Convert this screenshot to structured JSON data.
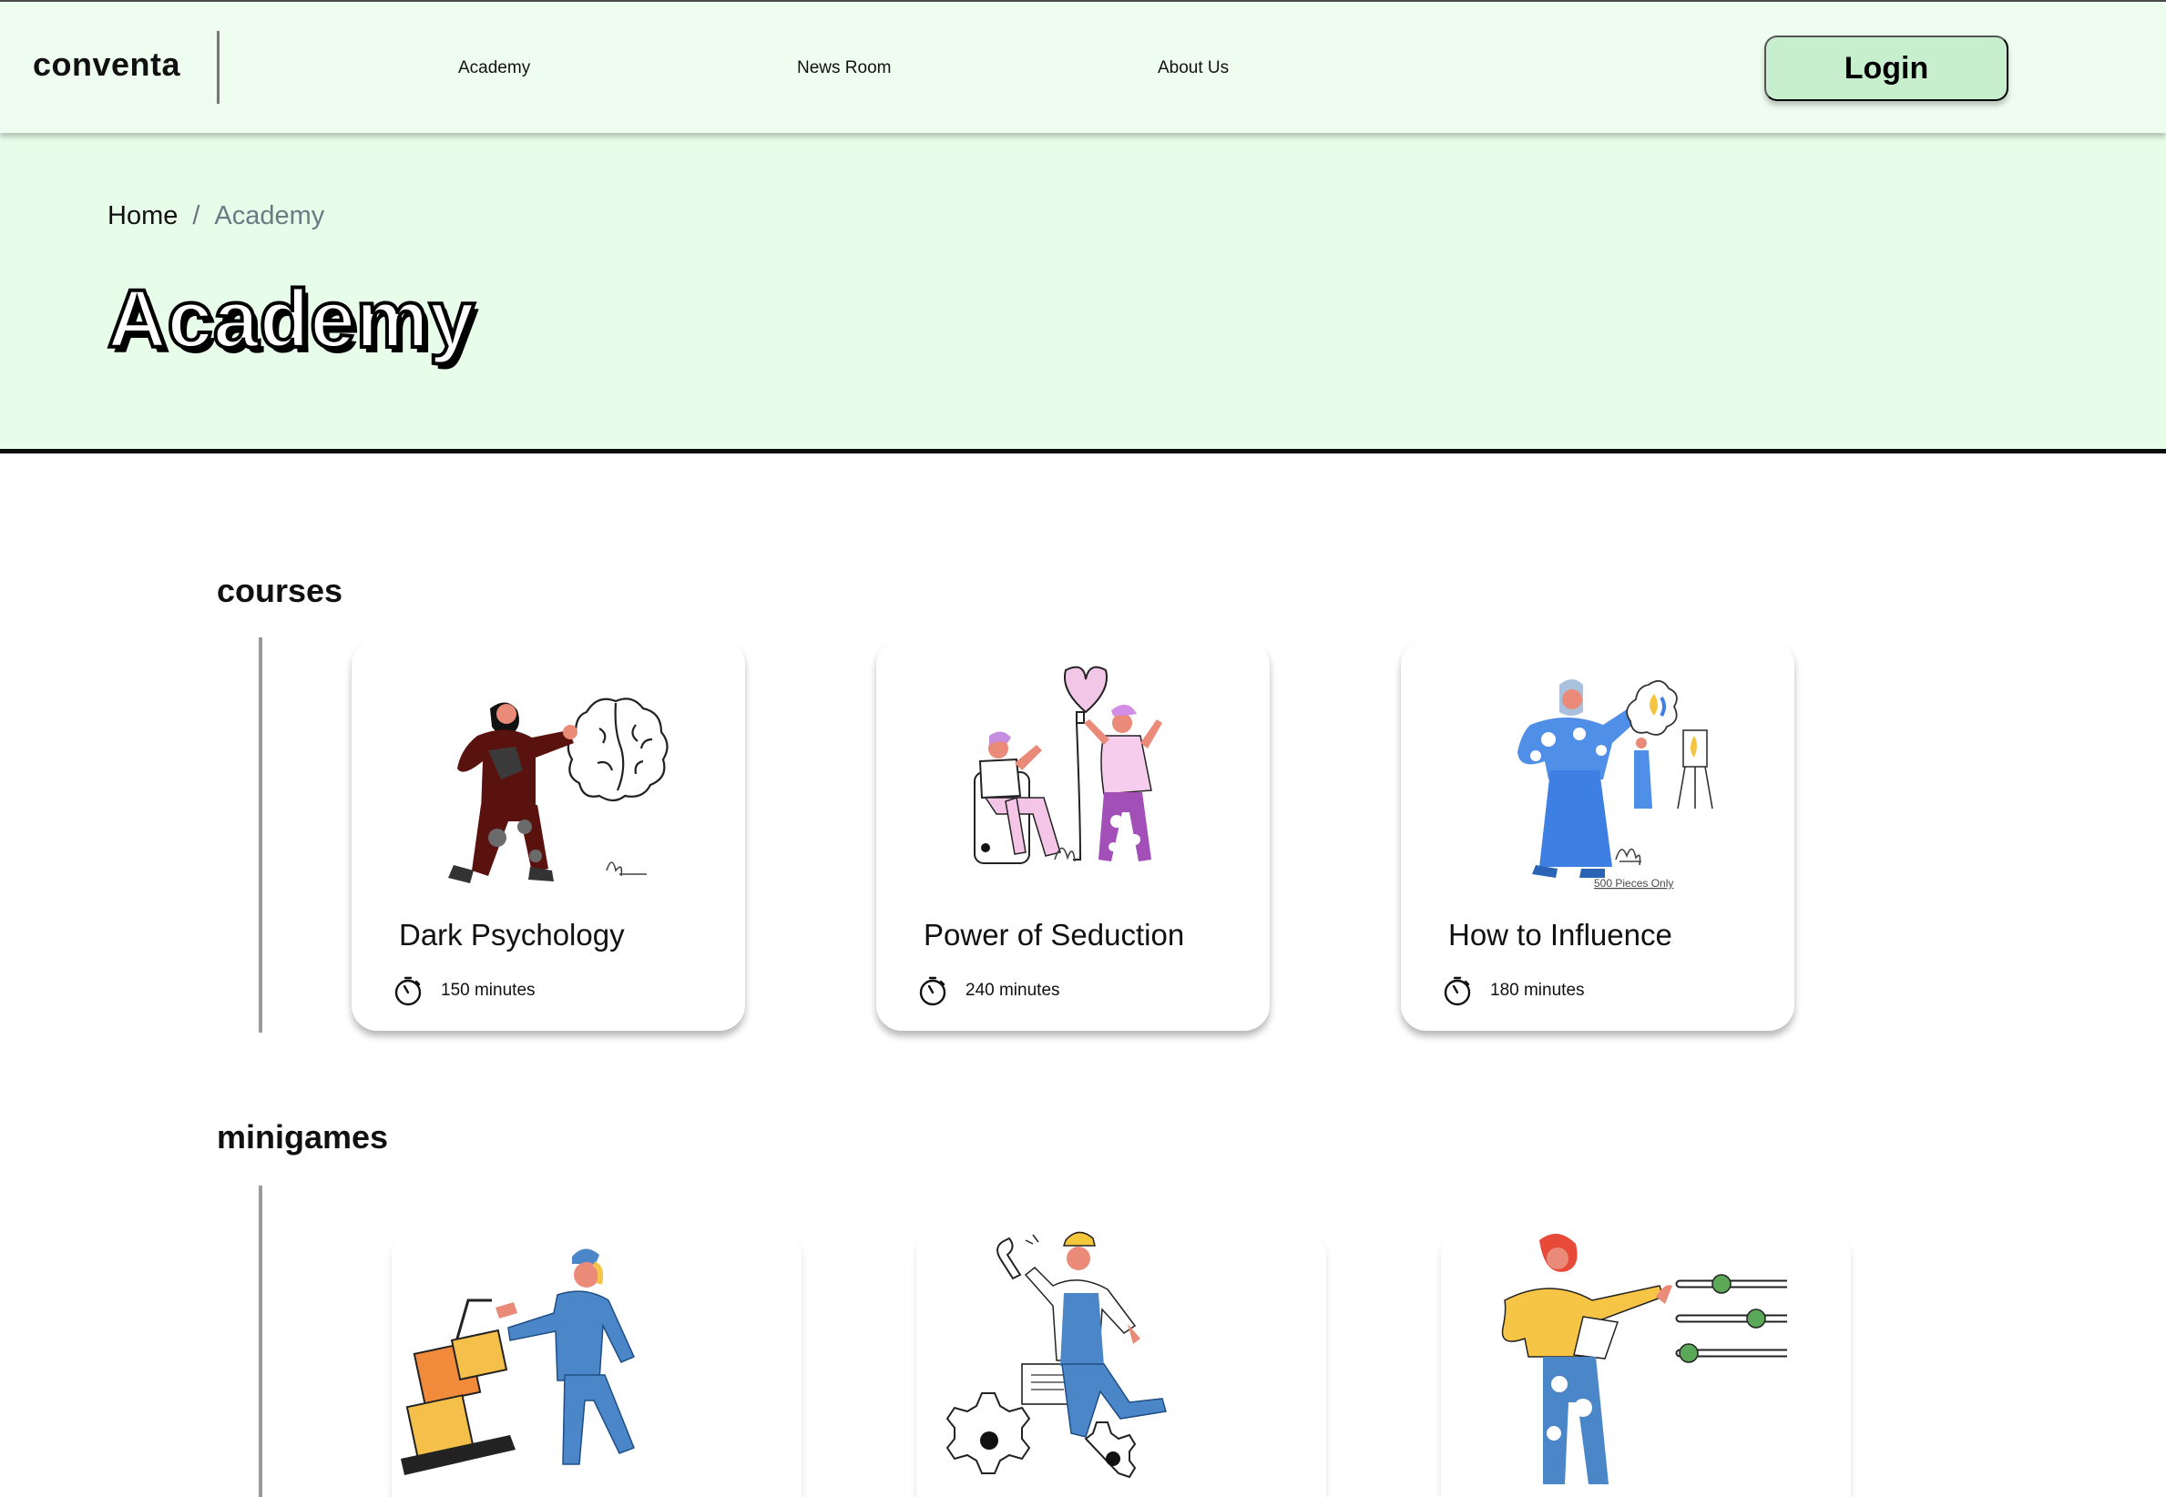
{
  "nav": {
    "brand": "conventa",
    "links": [
      "Academy",
      "News Room",
      "About Us"
    ],
    "login_label": "Login"
  },
  "hero": {
    "breadcrumb": {
      "home": "Home",
      "separator": "/",
      "current": "Academy"
    },
    "title": "Academy"
  },
  "courses": {
    "heading": "courses",
    "items": [
      {
        "title": "Dark Psychology",
        "duration": "150 minutes",
        "icon": "stopwatch-icon"
      },
      {
        "title": "Power of Seduction",
        "duration": "240 minutes",
        "icon": "stopwatch-icon"
      },
      {
        "title": "How to Influence",
        "duration": "180 minutes",
        "icon": "stopwatch-icon",
        "illustration_caption": "500 Pieces Only"
      }
    ]
  },
  "minigames": {
    "heading": "minigames"
  },
  "colors": {
    "nav_bg": "#effdf0",
    "hero_bg": "#e8fde9",
    "login_bg": "#c7efcd",
    "rail": "#9a9a9a"
  }
}
